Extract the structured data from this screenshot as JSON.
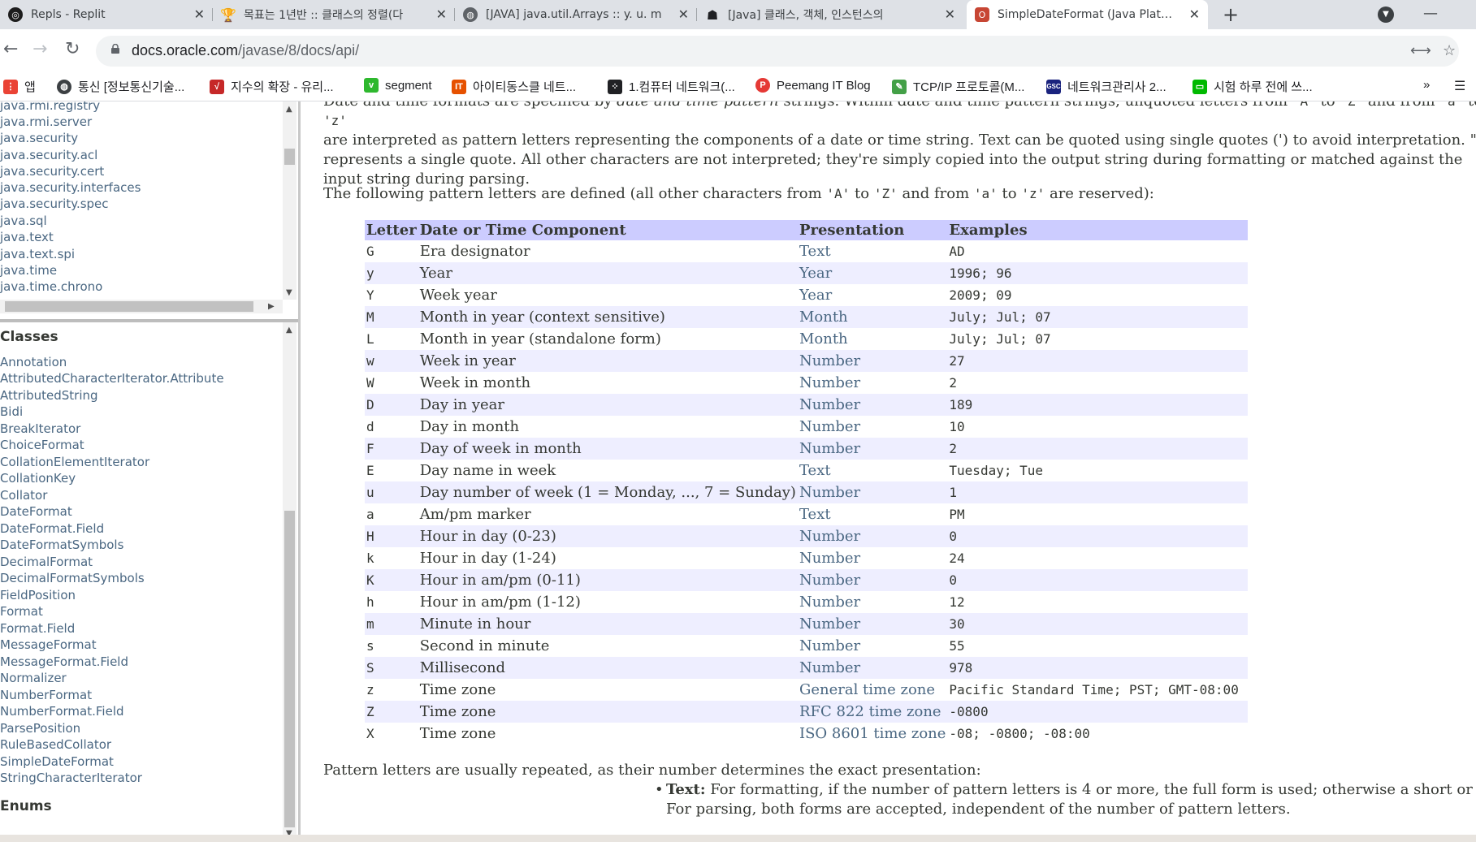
{
  "browser": {
    "tabs": [
      {
        "title": "Repls - Replit",
        "icon": "replit-icon",
        "color": "#1d1d1d"
      },
      {
        "title": "목표는 1년반 :: 클래스의 정렬(다",
        "icon": "trophy-icon",
        "color": "#8a6d00"
      },
      {
        "title": "[JAVA] java.util.Arrays :: y. u. m",
        "icon": "globe-icon",
        "color": "#5f6368"
      },
      {
        "title": "[Java] 클래스, 객체, 인스턴스의",
        "icon": "ghost-icon",
        "color": "#202124"
      },
      {
        "title": "SimpleDateFormat (Java Platform",
        "icon": "oracle-icon",
        "color": "#c74634"
      }
    ],
    "new_tab": "+",
    "url_host": "docs.oracle.com",
    "url_path": "/javase/8/docs/api/",
    "bookmarks": [
      {
        "label": "앱",
        "icon": "apps-grid-icon",
        "color": "#ea4335"
      },
      {
        "label": "통신 [정보통신기술...",
        "icon": "globe-icon",
        "color": "#3c4043"
      },
      {
        "label": "지수의 확장 - 유리...",
        "icon": "sqrt-icon",
        "color": "#c62828"
      },
      {
        "label": "segment",
        "icon": "v-icon",
        "color": "#2eb82e"
      },
      {
        "label": "아이티동스클 네트...",
        "icon": "it-icon",
        "color": "#e65100"
      },
      {
        "label": "1.컴퓨터 네트워크(...",
        "icon": "dots-icon",
        "color": "#202124"
      },
      {
        "label": "Peemang IT Blog",
        "icon": "peemang-icon",
        "color": "#e53935"
      },
      {
        "label": "TCP/IP 프로토콜(M...",
        "icon": "pen-icon",
        "color": "#43a047"
      },
      {
        "label": "네트워크관리사 2...",
        "icon": "gsc-icon",
        "color": "#1a237e"
      },
      {
        "label": "시험 하루 전에 쓰...",
        "icon": "chat-icon",
        "color": "#00b900"
      }
    ],
    "bookmarks_more": "»"
  },
  "packages": [
    "java.rmi.registry",
    "java.rmi.server",
    "java.security",
    "java.security.acl",
    "java.security.cert",
    "java.security.interfaces",
    "java.security.spec",
    "java.sql",
    "java.text",
    "java.text.spi",
    "java.time",
    "java.time.chrono"
  ],
  "classes_heading": "Classes",
  "classes": [
    "Annotation",
    "AttributedCharacterIterator.Attribute",
    "AttributedString",
    "Bidi",
    "BreakIterator",
    "ChoiceFormat",
    "CollationElementIterator",
    "CollationKey",
    "Collator",
    "DateFormat",
    "DateFormat.Field",
    "DateFormatSymbols",
    "DecimalFormat",
    "DecimalFormatSymbols",
    "FieldPosition",
    "Format",
    "Format.Field",
    "MessageFormat",
    "MessageFormat.Field",
    "Normalizer",
    "NumberFormat",
    "NumberFormat.Field",
    "ParsePosition",
    "RuleBasedCollator",
    "SimpleDateFormat",
    "StringCharacterIterator"
  ],
  "enums_heading": "Enums",
  "doc": {
    "intro_line1_a": "Date and time formats are specified by ",
    "intro_line1_em": "date and time pattern",
    "intro_line1_b": " strings. Within date and time pattern strings, unquoted letters from ",
    "intro_A": "'A'",
    "intro_to1": " to ",
    "intro_Z": "'Z'",
    "intro_and": " and from ",
    "intro_a": "'a'",
    "intro_to2": " to ",
    "intro_z": "'z'",
    "intro_rest": "are interpreted as pattern letters representing the components of a date or time string. Text can be quoted using single quotes (') to avoid interpretation. \"''\" represents a single quote. All other characters are not interpreted; they're simply copied into the output string during formatting or matched against the input string during parsing.",
    "following_a": "The following pattern letters are defined (all other characters from ",
    "following_A": "'A'",
    "following_to1": " to ",
    "following_Z": "'Z'",
    "following_and": " and from ",
    "following_a2": "'a'",
    "following_to2": " to ",
    "following_z": "'z'",
    "following_end": " are reserved):",
    "table_headers": [
      "Letter",
      "Date or Time Component",
      "Presentation",
      "Examples"
    ],
    "table_rows": [
      [
        "G",
        "Era designator",
        "Text",
        "AD"
      ],
      [
        "y",
        "Year",
        "Year",
        "1996; 96"
      ],
      [
        "Y",
        "Week year",
        "Year",
        "2009; 09"
      ],
      [
        "M",
        "Month in year (context sensitive)",
        "Month",
        "July; Jul; 07"
      ],
      [
        "L",
        "Month in year (standalone form)",
        "Month",
        "July; Jul; 07"
      ],
      [
        "w",
        "Week in year",
        "Number",
        "27"
      ],
      [
        "W",
        "Week in month",
        "Number",
        "2"
      ],
      [
        "D",
        "Day in year",
        "Number",
        "189"
      ],
      [
        "d",
        "Day in month",
        "Number",
        "10"
      ],
      [
        "F",
        "Day of week in month",
        "Number",
        "2"
      ],
      [
        "E",
        "Day name in week",
        "Text",
        "Tuesday; Tue"
      ],
      [
        "u",
        "Day number of week (1 = Monday, ..., 7 = Sunday)",
        "Number",
        "1"
      ],
      [
        "a",
        "Am/pm marker",
        "Text",
        "PM"
      ],
      [
        "H",
        "Hour in day (0-23)",
        "Number",
        "0"
      ],
      [
        "k",
        "Hour in day (1-24)",
        "Number",
        "24"
      ],
      [
        "K",
        "Hour in am/pm (0-11)",
        "Number",
        "0"
      ],
      [
        "h",
        "Hour in am/pm (1-12)",
        "Number",
        "12"
      ],
      [
        "m",
        "Minute in hour",
        "Number",
        "30"
      ],
      [
        "s",
        "Second in minute",
        "Number",
        "55"
      ],
      [
        "S",
        "Millisecond",
        "Number",
        "978"
      ],
      [
        "z",
        "Time zone",
        "General time zone",
        "Pacific Standard Time; PST; GMT-08:00"
      ],
      [
        "Z",
        "Time zone",
        "RFC 822 time zone",
        "-0800"
      ],
      [
        "X",
        "Time zone",
        "ISO 8601 time zone",
        "-08; -0800; -08:00"
      ]
    ],
    "repeat_note": "Pattern letters are usually repeated, as their number determines the exact presentation:",
    "text_bullet_label": "Text:",
    "text_bullet_body": " For formatting, if the number of pattern letters is 4 or more, the full form is used; otherwise a short or abbreviated form is used if available. For parsing, both forms are accepted, independent of the number of pattern letters."
  }
}
